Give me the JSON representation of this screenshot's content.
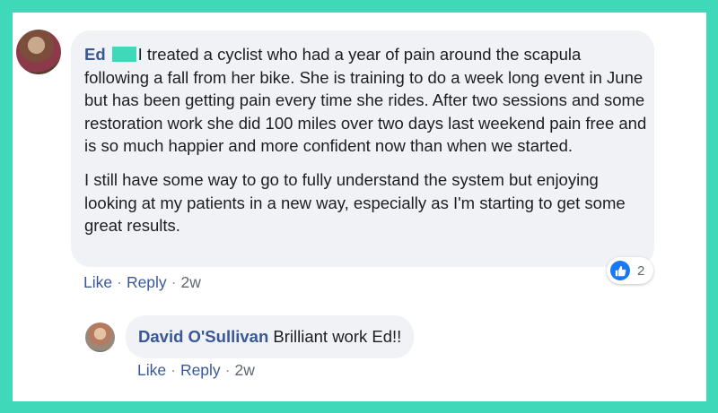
{
  "comment": {
    "author": "Ed",
    "para1": "I treated a cyclist who had a year of pain around the scapula following a fall from her bike. She is training to do a week long event in June but has been getting pain every time she rides. After two sessions and some restoration work she did 100 miles over two days last weekend pain free and is so much happier and more confident now than when we started.",
    "para2": "I still have some way to go to fully understand the system but enjoying looking at my patients in a new way, especially as I'm starting to get some great results.",
    "like": "Like",
    "reply": "Reply",
    "time": "2w",
    "reaction_count": "2"
  },
  "reply": {
    "author": "David O'Sullivan",
    "text": "Brilliant work Ed!!",
    "like": "Like",
    "reply": "Reply",
    "time": "2w"
  },
  "colors": {
    "frame": "#3fd9b9",
    "author_link": "#385898",
    "bubble": "#f0f2f5",
    "like_blue": "#1877f2"
  },
  "icons": {
    "reaction": "thumbs-up-icon"
  }
}
